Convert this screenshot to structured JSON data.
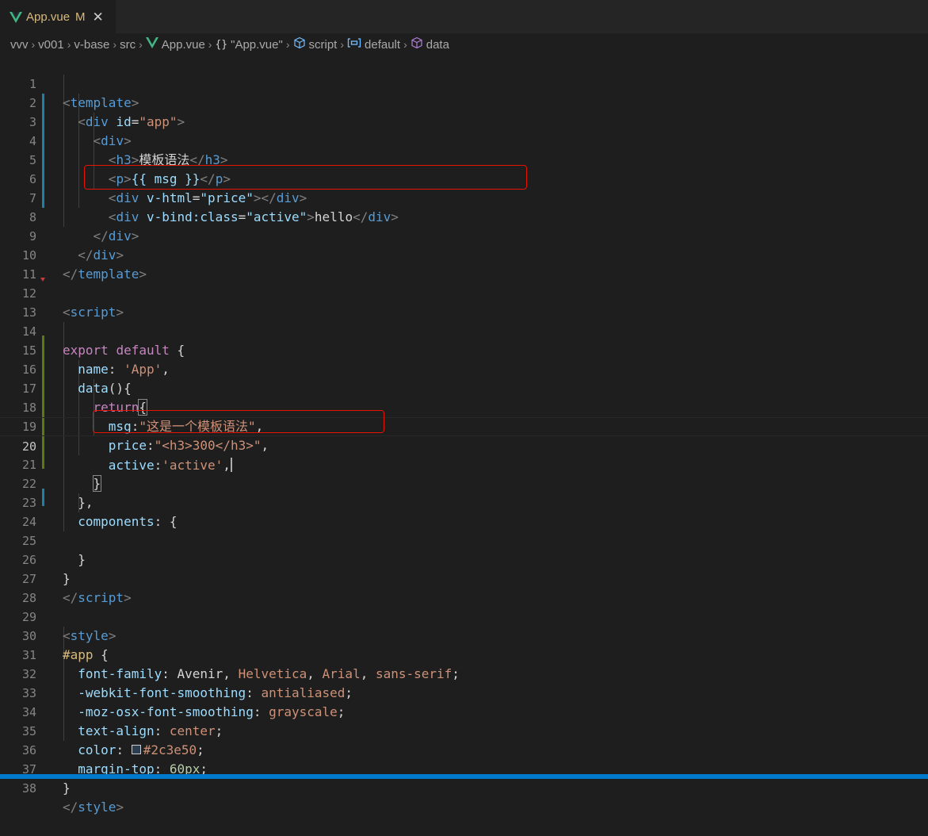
{
  "tab": {
    "filename": "App.vue",
    "status": "M",
    "close": "✕",
    "icon": "vue-icon"
  },
  "breadcrumb": {
    "items": [
      "vvv",
      "v001",
      "v-base",
      "src",
      "App.vue",
      "\"App.vue\"",
      "script",
      "default",
      "data"
    ],
    "separator": "›"
  },
  "line_numbers": [
    "1",
    "2",
    "3",
    "4",
    "5",
    "6",
    "7",
    "8",
    "9",
    "10",
    "11",
    "12",
    "13",
    "14",
    "15",
    "16",
    "17",
    "18",
    "19",
    "20",
    "21",
    "22",
    "23",
    "24",
    "25",
    "26",
    "27",
    "28",
    "29",
    "30",
    "31",
    "32",
    "33",
    "34",
    "35",
    "36",
    "37",
    "38"
  ],
  "current_line": "20",
  "code": {
    "l1": [
      "<",
      "template",
      ">"
    ],
    "l2": [
      "<",
      "div",
      "id",
      "=",
      "\"app\"",
      ">"
    ],
    "l3": [
      "<",
      "div",
      ">"
    ],
    "l4": [
      "<",
      "h3",
      ">",
      "模板语法",
      "</",
      "h3",
      ">"
    ],
    "l5": [
      "<",
      "p",
      ">",
      "{{ msg }}",
      "</",
      "p",
      ">"
    ],
    "l6": [
      "<",
      "div",
      "v-html",
      "=",
      "\"price\"",
      "></",
      "div",
      ">"
    ],
    "l7": [
      "<",
      "div",
      "v-bind:class",
      "=",
      "\"active\"",
      ">",
      "hello",
      "</",
      "div",
      ">"
    ],
    "l8": [
      "</",
      "div",
      ">"
    ],
    "l9": [
      "</",
      "div",
      ">"
    ],
    "l10": [
      "</",
      "template",
      ">"
    ],
    "l12": [
      "<",
      "script",
      ">"
    ],
    "l14": [
      "export",
      "default",
      "{"
    ],
    "l15": [
      "name",
      ": ",
      "'App'",
      ","
    ],
    "l16": [
      "data",
      "(){"
    ],
    "l17": [
      "return",
      "{"
    ],
    "l18": [
      "msg",
      ":",
      "\"这是一个模板语法\"",
      ","
    ],
    "l19": [
      "price",
      ":",
      "\"<h3>300</h3>\"",
      ","
    ],
    "l20": [
      "active",
      ":",
      "'active'",
      ","
    ],
    "l21": [
      "}"
    ],
    "l22": [
      "},"
    ],
    "l23": [
      "components",
      ": {"
    ],
    "l25": [
      "}"
    ],
    "l26": [
      "}"
    ],
    "l27": [
      "</",
      "script",
      ">"
    ],
    "l29": [
      "<",
      "style",
      ">"
    ],
    "l30": [
      "#app",
      " {"
    ],
    "l31": [
      "font-family",
      ": ",
      "Avenir",
      ", ",
      "Helvetica",
      ", ",
      "Arial",
      ", ",
      "sans-serif",
      ";"
    ],
    "l32": [
      "-webkit-font-smoothing",
      ": ",
      "antialiased",
      ";"
    ],
    "l33": [
      "-moz-osx-font-smoothing",
      ": ",
      "grayscale",
      ";"
    ],
    "l34": [
      "text-align",
      ": ",
      "center",
      ";"
    ],
    "l35": [
      "color",
      ": ",
      "#2c3e50",
      ";"
    ],
    "l36": [
      "margin-top",
      ": ",
      "60px",
      ";"
    ],
    "l37": [
      "}"
    ],
    "l38": [
      "</",
      "style",
      ">"
    ]
  },
  "colors": {
    "editor_bg": "#1e1e1e",
    "tag_name": "#569cd6",
    "attribute": "#9cdcfe",
    "string": "#ce9178",
    "keyword": "#c586c0",
    "highlight_box": "#e51400",
    "status_bar": "#007acc",
    "swatch_color": "#2c3e50"
  }
}
